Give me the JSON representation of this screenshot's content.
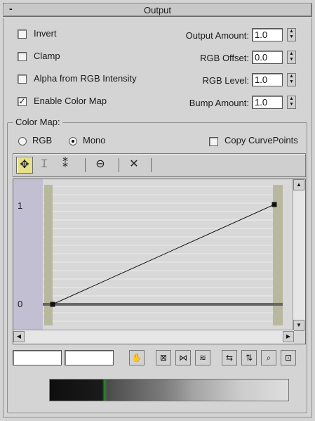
{
  "rollout": {
    "collapse_symbol": "-",
    "title": "Output"
  },
  "options": [
    {
      "label": "Invert",
      "checked": false
    },
    {
      "label": "Clamp",
      "checked": false
    },
    {
      "label": "Alpha from RGB Intensity",
      "checked": false
    },
    {
      "label": "Enable Color Map",
      "checked": true
    }
  ],
  "spinners": [
    {
      "label": "Output Amount:",
      "value": "1.0"
    },
    {
      "label": "RGB Offset:",
      "value": "0.0"
    },
    {
      "label": "RGB Level:",
      "value": "1.0"
    },
    {
      "label": "Bump Amount:",
      "value": "1.0"
    }
  ],
  "color_map": {
    "title": "Color Map:",
    "mode_rgb": "RGB",
    "mode_mono": "Mono",
    "selected_mode": "Mono",
    "copy_curve_points": "Copy CurvePoints",
    "copy_curve_points_checked": false
  },
  "graph": {
    "y_top_label": "1",
    "y_bottom_label": "0",
    "curve_points": [
      {
        "x": 0.0,
        "y": 0.0
      },
      {
        "x": 1.0,
        "y": 1.0
      }
    ]
  },
  "toolbar": {
    "move_icon": "move-points-icon",
    "scale_icon": "scale-point-icon",
    "insert_icon": "add-point-icon",
    "reset_icon": "reset-curve-icon",
    "delete_icon": "delete-point-icon"
  },
  "bottom": {
    "coord_x": "",
    "coord_y": "",
    "tools": [
      "pan-icon",
      "zoom-extents-icon",
      "zoom-horizontal-extents-icon",
      "zoom-vertical-extents-icon",
      "zoom-horizontal-icon",
      "zoom-vertical-icon",
      "zoom-icon",
      "zoom-region-icon"
    ]
  },
  "colors": {
    "panel": "#d4d4d4",
    "active_tool": "#e6e08a",
    "graph_left_band": "#c3bfd2"
  }
}
